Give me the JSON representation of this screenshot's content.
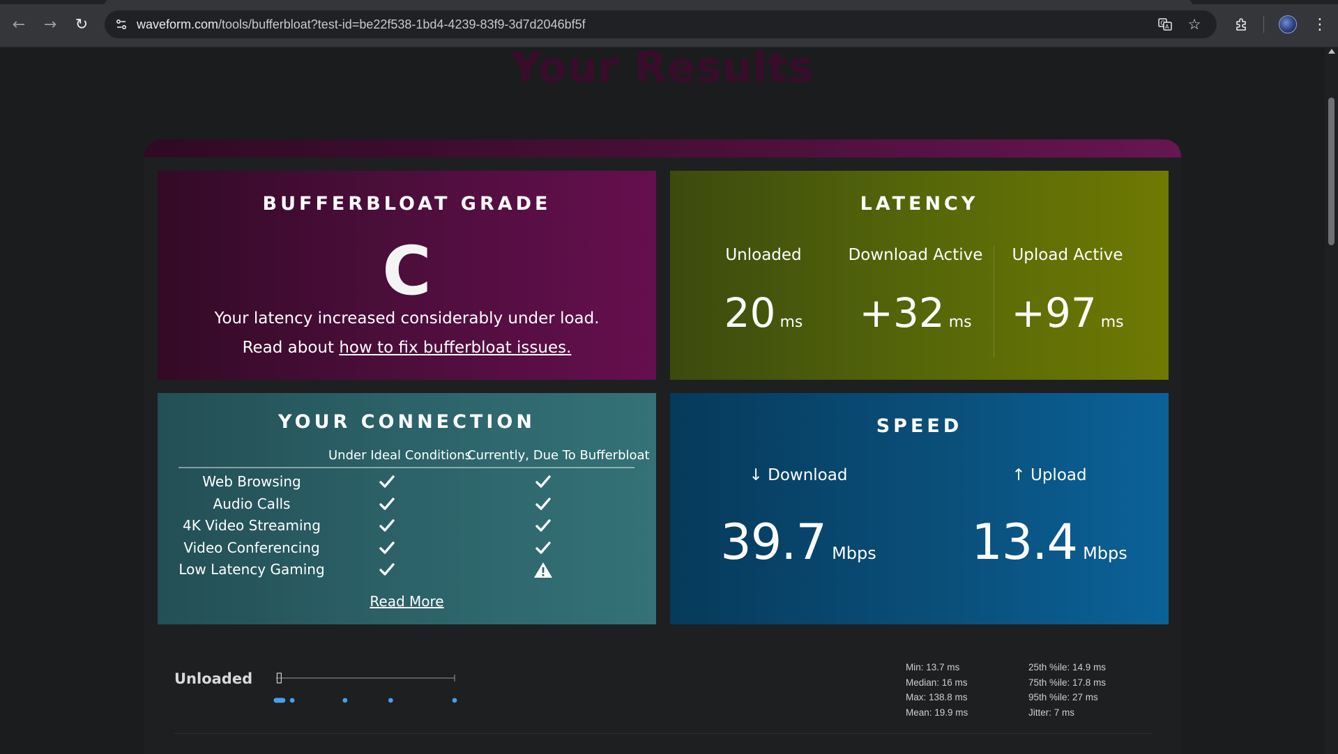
{
  "browser": {
    "url_host": "waveform.com",
    "url_path": "/tools/bufferbloat?test-id=be22f538-1bd4-4239-83f9-3d7d2046bf5f"
  },
  "page": {
    "title": "Your Results"
  },
  "grade": {
    "title": "BUFFERBLOAT GRADE",
    "letter": "C",
    "description": "Your latency increased considerably under load.",
    "read_prefix": "Read about ",
    "read_link": "how to fix bufferbloat issues."
  },
  "latency": {
    "title": "LATENCY",
    "columns": [
      {
        "label": "Unloaded",
        "value": "20",
        "unit": "ms"
      },
      {
        "label": "Download Active",
        "value": "+32",
        "unit": "ms"
      },
      {
        "label": "Upload Active",
        "value": "+97",
        "unit": "ms"
      }
    ]
  },
  "connection": {
    "title": "YOUR CONNECTION",
    "col_ideal": "Under Ideal Conditions",
    "col_current": "Currently, Due To Bufferbloat",
    "rows": [
      {
        "label": "Web Browsing",
        "ideal": "check",
        "current": "check"
      },
      {
        "label": "Audio Calls",
        "ideal": "check",
        "current": "check"
      },
      {
        "label": "4K Video Streaming",
        "ideal": "check",
        "current": "check"
      },
      {
        "label": "Video Conferencing",
        "ideal": "check",
        "current": "check"
      },
      {
        "label": "Low Latency Gaming",
        "ideal": "check",
        "current": "warning"
      }
    ],
    "read_more": "Read More"
  },
  "speed": {
    "title": "SPEED",
    "download": {
      "label": "↓ Download",
      "value": "39.7",
      "unit": "Mbps"
    },
    "upload": {
      "label": "↑ Upload",
      "value": "13.4",
      "unit": "Mbps"
    }
  },
  "unloaded_dist": {
    "label": "Unloaded",
    "stats_left": [
      "Min: 13.7 ms",
      "Median: 16 ms",
      "Max: 138.8 ms",
      "Mean: 19.9 ms"
    ],
    "stats_right": [
      "25th %ile: 14.9 ms",
      "75th %ile: 17.8 ms",
      "95th %ile: 27 ms",
      "Jitter: 7 ms"
    ],
    "min_ms": 13.7,
    "max_ms": 138.8,
    "outlier_samples_ms": [
      25,
      62,
      94,
      138.8
    ],
    "colors": {
      "points": "#4a9fe8",
      "whisker": "#9a9a9a"
    }
  },
  "colors": {
    "grade_panel": "#4d0e3c",
    "latency_panel": "#556609",
    "connection_panel": "#2c6269",
    "speed_panel": "#0a4f7a",
    "check": "#ffffff"
  }
}
